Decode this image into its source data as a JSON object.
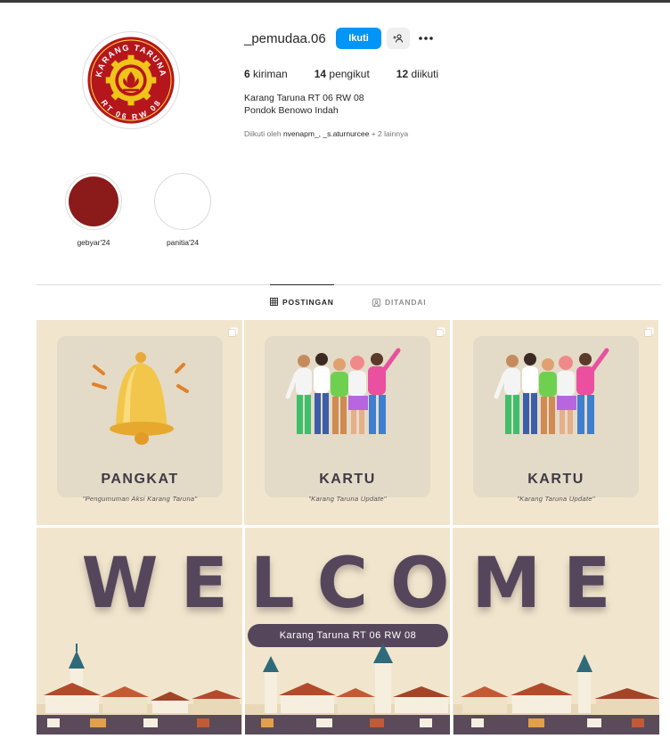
{
  "profile": {
    "username": "_pemudaa.06",
    "follow_label": "Ikuti",
    "suggest_icon": "add-person-icon",
    "more_icon": "more-options-icon",
    "stats": {
      "posts_count": "6",
      "posts_label": "kiriman",
      "followers_count": "14",
      "followers_label": "pengikut",
      "following_count": "12",
      "following_label": "diikuti"
    },
    "bio_line1": "Karang Taruna RT 06 RW 08",
    "bio_line2": "Pondok Benowo Indah",
    "followed_by_prefix": "Diikuti oleh",
    "followed_by_names": "nvenapm_, _s.aturnurcee",
    "followed_by_suffix": "+ 2 lainnya",
    "logo_text_top": "KARANG TARUNA",
    "logo_text_bottom": "RT 06 RW 08"
  },
  "highlights": [
    {
      "label": "gebyar'24",
      "color": "#8b1a1a"
    },
    {
      "label": "panitia'24",
      "color": "#ffffff"
    }
  ],
  "tabs": [
    {
      "label": "POSTINGAN",
      "icon": "grid-icon",
      "active": true
    },
    {
      "label": "DITANDAI",
      "icon": "tagged-icon",
      "active": false
    }
  ],
  "posts": [
    {
      "title": "PANGKAT",
      "subtitle": "\"Pengumuman Aksi Karang Taruna\"",
      "image": "bell-icon"
    },
    {
      "title": "KARTU",
      "subtitle": "\"Karang Taruna Update\"",
      "image": "people-group"
    },
    {
      "title": "KARTU",
      "subtitle": "\"Karang Taruna Update\"",
      "image": "people-group"
    }
  ],
  "welcome": {
    "letters": [
      "W",
      "E",
      "L",
      "C",
      "O",
      "M",
      "E"
    ],
    "pill": "Karang Taruna RT 06 RW 08"
  },
  "colors": {
    "accent": "#0095f6",
    "post_bg": "#f1e6cd",
    "welcome_text": "#56465c"
  }
}
